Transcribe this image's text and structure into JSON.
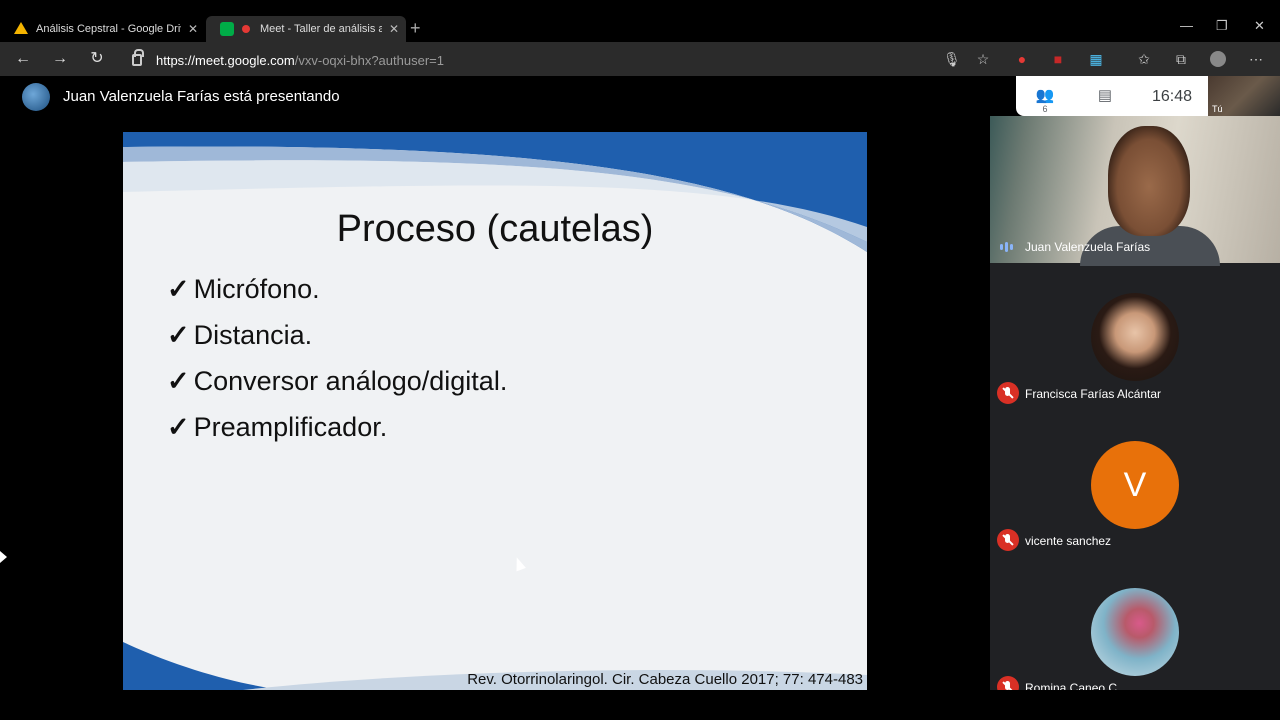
{
  "browser": {
    "tabs": [
      {
        "title": "Análisis Cepstral - Google Drive",
        "close": "✕"
      },
      {
        "title": "Meet - Taller de análisis acú",
        "close": "✕"
      }
    ],
    "new_tab": "+",
    "window_controls": {
      "minimize": "—",
      "restore": "❐",
      "close": "✕"
    },
    "url_host": "https://meet.google.com",
    "url_path": "/vxv-oqxi-bhx?authuser=1"
  },
  "meet": {
    "presenting_text": "Juan Valenzuela Farías está presentando",
    "people_badge": "6",
    "time": "16:48",
    "self_label": "Tú"
  },
  "slide": {
    "title": "Proceso (cautelas)",
    "check": "✓",
    "bullets": [
      "Micrófono.",
      "Distancia.",
      "Conversor análogo/digital.",
      "Preamplificador."
    ],
    "reference": "Rev. Otorrinolaringol. Cir. Cabeza Cuello 2017; 77: 474-483"
  },
  "participants": [
    {
      "name": "Juan Valenzuela Farías",
      "muted": false
    },
    {
      "name": "Francisca Farías Alcántar",
      "muted": true
    },
    {
      "name": "vicente sanchez",
      "muted": true,
      "initial": "V"
    },
    {
      "name": "Romina Caneo C.",
      "muted": true
    }
  ],
  "colors": {
    "avatar_orange": "#e8710a",
    "muted_red": "#d93025",
    "slide_blue": "#1f5fae"
  }
}
